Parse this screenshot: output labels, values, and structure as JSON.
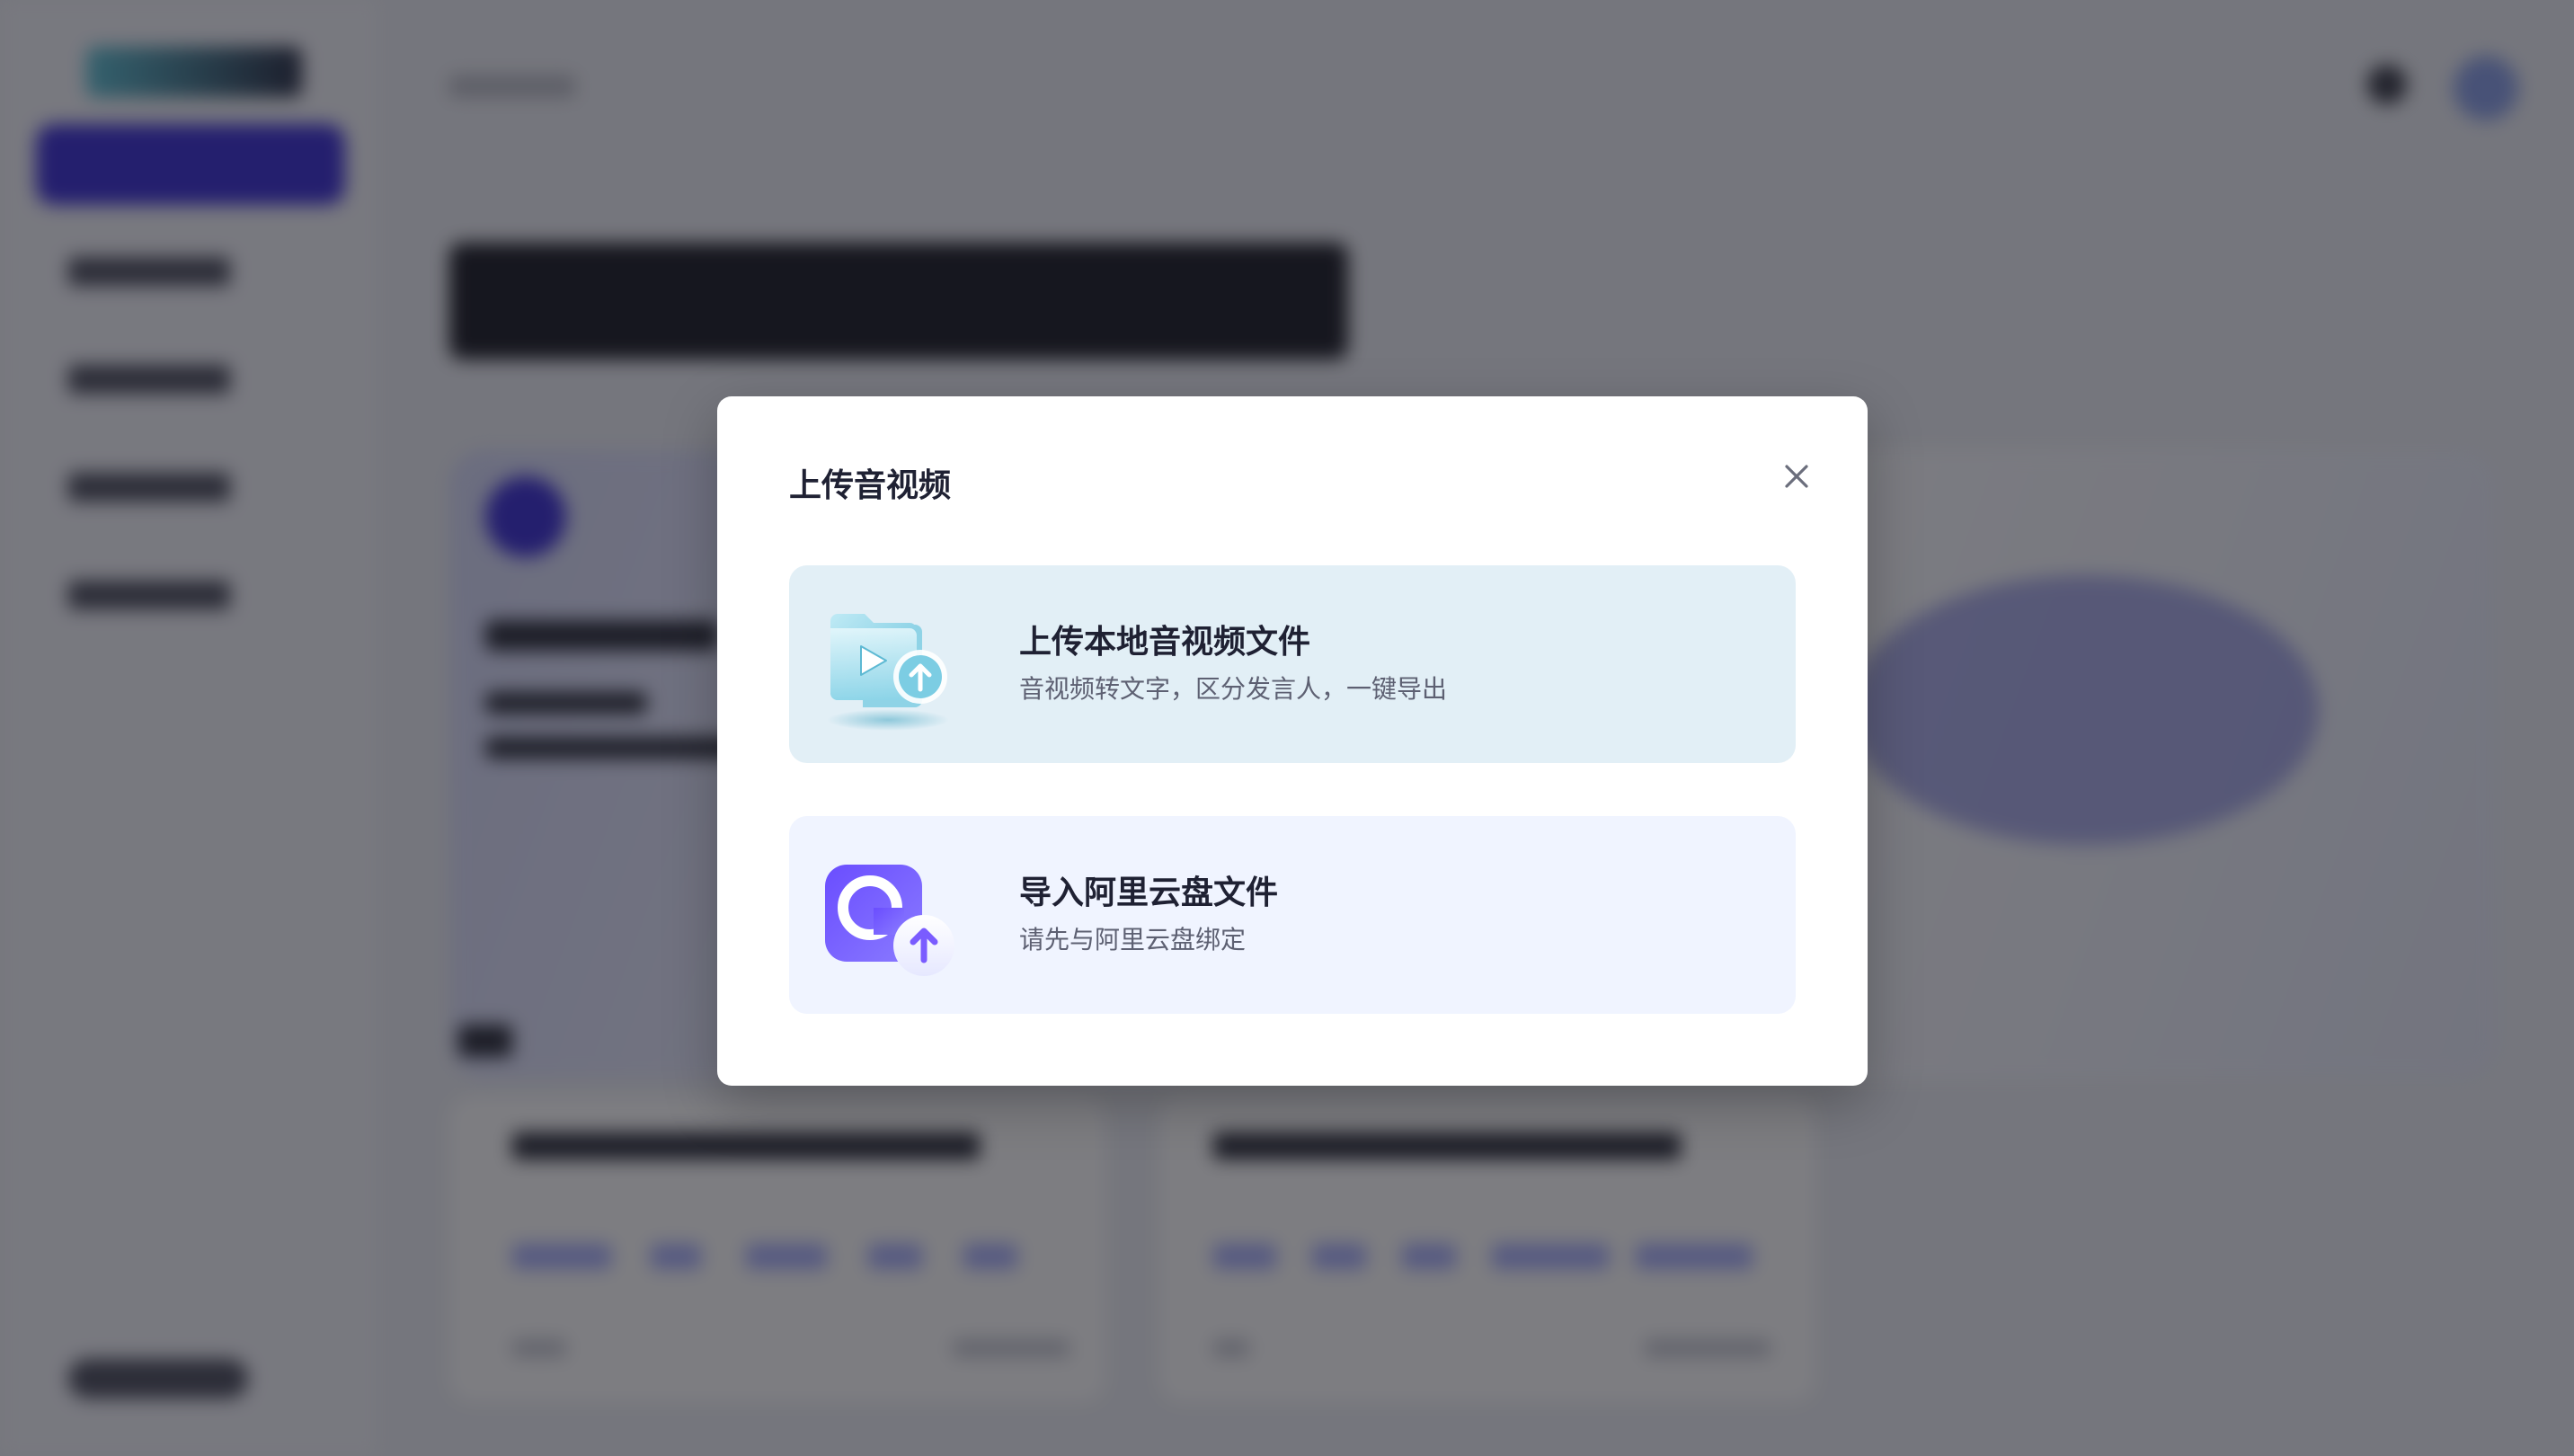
{
  "modal": {
    "title": "上传音视频",
    "close_icon": "close-icon",
    "options": [
      {
        "icon": "video-folder-upload-icon",
        "title": "上传本地音视频文件",
        "description": "音视频转文字，区分发言人，一键导出"
      },
      {
        "icon": "aliyun-drive-upload-icon",
        "title": "导入阿里云盘文件",
        "description": "请先与阿里云盘绑定"
      }
    ]
  },
  "colors": {
    "accent": "#3b2fd6",
    "local_option_bg": "#e2eff6",
    "aliyun_option_bg": "#f0f4ff"
  }
}
